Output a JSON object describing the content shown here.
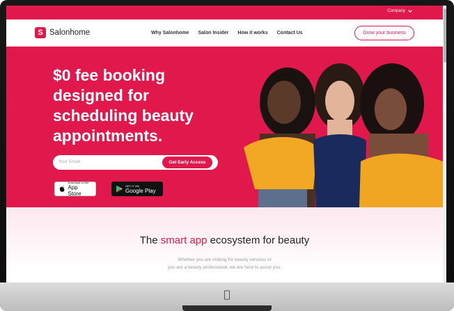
{
  "topbar": {
    "company_label": "Company"
  },
  "nav": {
    "logo_letter": "S",
    "brand": "Salonhome",
    "items": [
      "Why Salonhome",
      "Salon Insider",
      "How it works",
      "Contact Us"
    ],
    "cta": "Grow your business"
  },
  "hero": {
    "headline_lines": [
      "$0 fee booking",
      "designed for",
      "scheduling beauty",
      "appointments."
    ],
    "email_placeholder": "Your Email",
    "early_access": "Get Early Access",
    "appstore_small": "Download on the",
    "appstore_big": "App Store",
    "gplay_small": "GET IT ON",
    "gplay_big": "Google Play"
  },
  "section2": {
    "title_pre": "The ",
    "title_highlight": "smart app",
    "title_post": " ecosystem for beauty",
    "sub_line1": "Whether you are looking for beauty services or",
    "sub_line2": "you are a beauty professional, we are here to assist you."
  },
  "colors": {
    "brand": "#e0184c",
    "hero_bg": "#e0184c",
    "yellow_top": "#f3a823",
    "navy_top": "#1b2a5c"
  }
}
